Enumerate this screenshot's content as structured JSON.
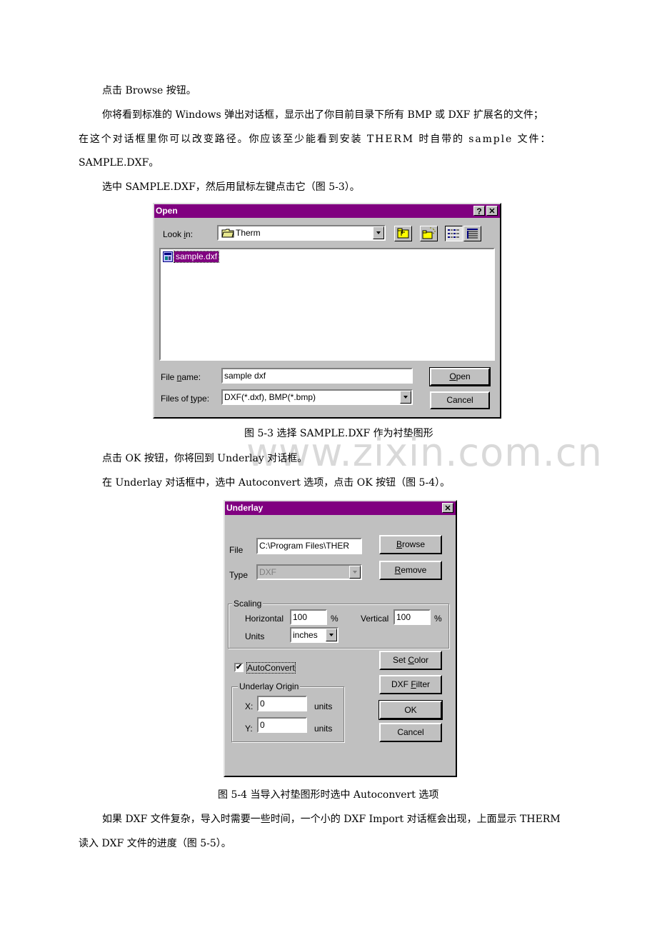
{
  "doc": {
    "p1": "点击 Browse 按钮。",
    "p2_line1": "你将看到标准的 Windows 弹出对话框，显示出了你目前目录下所有 BMP 或 DXF 扩展名的文件；",
    "p2_line2": "在这个对话框里你可以改变路径。你应该至少能看到安装 THERM 时自带的 sample 文件：",
    "p2_line3": "SAMPLE.DXF。",
    "p3": "选中 SAMPLE.DXF，然后用鼠标左键点击它（图 5-3）。",
    "fig3_caption": "图 5-3 选择 SAMPLE.DXF 作为衬垫图形",
    "p4": "点击 OK 按钮，你将回到 Underlay 对话框。",
    "p5": "在 Underlay 对话框中，选中 Autoconvert 选项，点击 OK 按钮（图 5-4）。",
    "fig4_caption": "图 5-4 当导入衬垫图形时选中 Autoconvert 选项",
    "p6_line1": "如果 DXF 文件复杂，导入时需要一些时间，一个小的 DXF Import 对话框会出现，上面显示 THERM",
    "p6_line2": "读入 DXF 文件的进度（图 5-5）。",
    "watermark": "www.zixin.com.cn"
  },
  "open_dialog": {
    "title": "Open",
    "help_glyph": "?",
    "close_glyph": "✕",
    "look_in_label_pre": "Look ",
    "look_in_label_u": "i",
    "look_in_label_post": "n:",
    "look_in_value": "Therm",
    "files": [
      {
        "name": "sample.dxf",
        "selected": true
      }
    ],
    "file_name_label_pre": "File ",
    "file_name_label_u": "n",
    "file_name_label_post": "ame:",
    "file_name_value": "sample dxf",
    "files_of_type_label_pre": "Files of ",
    "files_of_type_label_u": "t",
    "files_of_type_label_post": "ype:",
    "files_of_type_value": "DXF(*.dxf), BMP(*.bmp)",
    "open_button_u": "O",
    "open_button_rest": "pen",
    "cancel_button": "Cancel",
    "colors": {
      "titlebar": "#800080",
      "selection": "#800080",
      "face": "#c0c0c0"
    }
  },
  "underlay_dialog": {
    "title": "Underlay",
    "close_glyph": "✕",
    "file_label": "File",
    "file_value": "C:\\Program Files\\THER",
    "type_label": "Type",
    "type_value": "DXF",
    "browse_u": "B",
    "browse_rest": "rowse",
    "remove_u": "R",
    "remove_rest": "emove",
    "scaling_group": "Scaling",
    "horizontal_label": "Horizontal",
    "horizontal_value": "100",
    "vertical_label": "Vertical",
    "vertical_value": "100",
    "percent": "%",
    "units_label": "Units",
    "units_value": "inches",
    "autoconvert_label": "AutoConvert",
    "autoconvert_checked": true,
    "check_glyph": "✔",
    "origin_group": "Underlay Origin",
    "x_label": "X:",
    "x_value": "0",
    "y_label": "Y:",
    "y_value": "0",
    "units_text": "units",
    "set_color_pre": "Set ",
    "set_color_u": "C",
    "set_color_post": "olor",
    "dxf_filter_pre": "DXF ",
    "dxf_filter_u": "F",
    "dxf_filter_post": "ilter",
    "ok_button": "OK",
    "cancel_button": "Cancel"
  }
}
